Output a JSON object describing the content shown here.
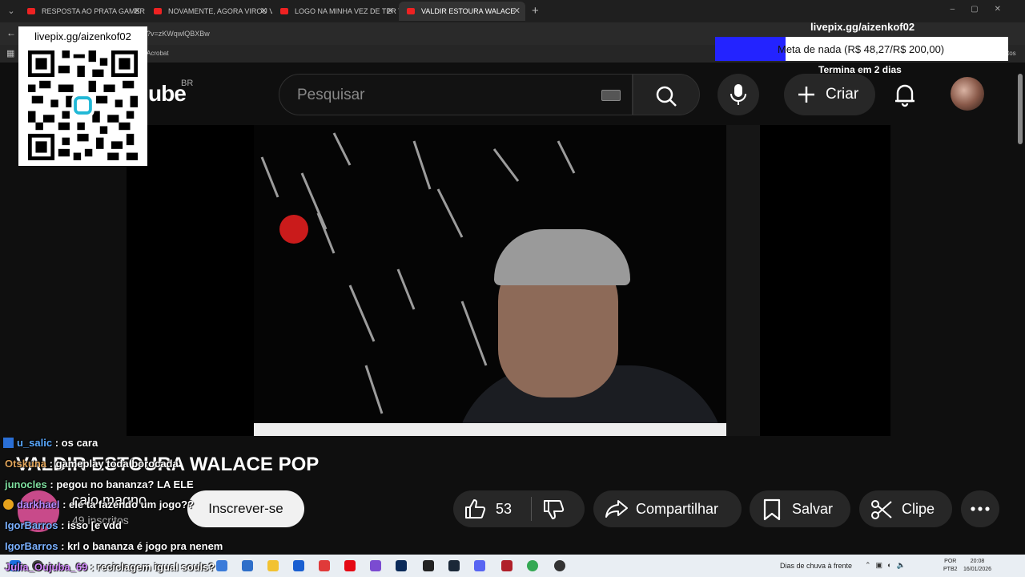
{
  "browser": {
    "tabs": [
      {
        "label": "RESPOSTA AO PRATA GAMER VI",
        "active": false
      },
      {
        "label": "NOVAMENTE, AGORA VIROU VI",
        "active": false
      },
      {
        "label": "LOGO NA MINHA VEZ DE TER TI",
        "active": false
      },
      {
        "label": "VALDIR ESTOURA WALACE",
        "active": true
      }
    ],
    "url": "?v=zKWqwlQBXBw",
    "bookmark": "Acrobat",
    "bookmark_right": "tos"
  },
  "overlay": {
    "qr_label": "livepix.gg/aizenkof02",
    "goal_user": "livepix.gg/aizenkof02",
    "goal_text": "Meta de nada (R$ 48,27/R$ 200,00)",
    "goal_progress": 0.2414,
    "goal_ends": "Termina em 2 dias",
    "goal_color": "#2323ff"
  },
  "youtube": {
    "logo_text": "ube",
    "region": "BR",
    "search_placeholder": "Pesquisar",
    "create_label": "Criar",
    "video_title": "VALDIR ESTOURA WALACE POP",
    "channel_name": "caio magno",
    "subscribers": "49 inscritos",
    "subscribe_label": "Inscrever-se",
    "likes": "53",
    "share_label": "Compartilhar",
    "save_label": "Salvar",
    "clip_label": "Clipe"
  },
  "chat": [
    {
      "user": "u_salic",
      "msg": ": os cara",
      "color": "#5aa9ff",
      "badge": "twitch"
    },
    {
      "user": "Otskuna",
      "msg": ": gameplay toda borocada",
      "color": "#e0a45a",
      "badge": ""
    },
    {
      "user": "junocles",
      "msg": ": pegou no bananza? LA ELE",
      "color": "#7fe0a0",
      "badge": ""
    },
    {
      "user": "darkhael",
      "msg": ": ele ta fazendo um jogo??",
      "color": "#b58aff",
      "badge": "warn"
    },
    {
      "user": "IgorBarros",
      "msg": ": isso [e vdd",
      "color": "#7ab0ff",
      "badge": ""
    },
    {
      "user": "IgorBarros",
      "msg": ": krl o bananza é jogo pra nenem",
      "color": "#7ab0ff",
      "badge": ""
    },
    {
      "user": "Julia_Oujuba_69",
      "msg": ": reciclagem igual souls?",
      "color": "#d58aff",
      "badge": ""
    }
  ],
  "taskbar": {
    "weather": "Dias de chuva à frente",
    "lang_top": "POR",
    "lang_bottom": "PTB2",
    "time": "20:08",
    "date": "16/01/2026"
  }
}
